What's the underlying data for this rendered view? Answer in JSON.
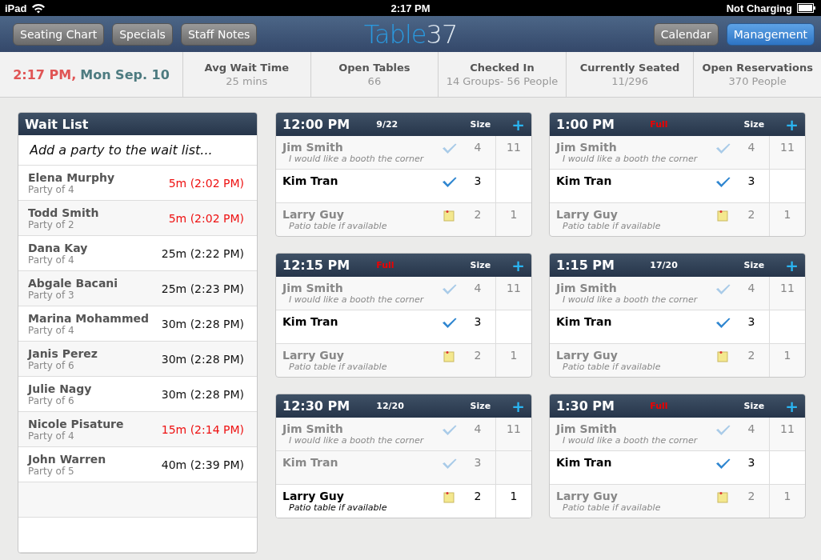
{
  "status_bar": {
    "device": "iPad",
    "time": "2:17 PM",
    "battery_text": "Not Charging"
  },
  "nav": {
    "left_buttons": [
      {
        "label": "Seating Chart",
        "selected": false
      },
      {
        "label": "Specials",
        "selected": false
      },
      {
        "label": "Staff Notes",
        "selected": false
      }
    ],
    "logo": {
      "part_1": "Table",
      "part_2": "37"
    },
    "right_buttons": [
      {
        "label": "Calendar",
        "selected": false
      },
      {
        "label": "Management",
        "selected": true
      }
    ]
  },
  "summary": {
    "time": "2:17 PM,",
    "date": "Mon Sep. 10",
    "stats": [
      {
        "label": "Avg Wait Time",
        "value": "25 mins"
      },
      {
        "label": "Open Tables",
        "value": "66"
      },
      {
        "label": "Checked In",
        "value": "14 Groups- 56 People"
      },
      {
        "label": "Currently Seated",
        "value": "11/296"
      },
      {
        "label": "Open Reservations",
        "value": "370 People"
      }
    ]
  },
  "wait_list": {
    "title": "Wait List",
    "placeholder": "Add a party to the wait list...",
    "parties": [
      {
        "name": "Elena Murphy",
        "party": "Party of 4",
        "wait": "5m (2:02 PM)",
        "overdue": true
      },
      {
        "name": "Todd Smith",
        "party": "Party of 2",
        "wait": "5m (2:02 PM)",
        "overdue": true
      },
      {
        "name": "Dana Kay",
        "party": "Party of 4",
        "wait": "25m (2:22 PM)",
        "overdue": false
      },
      {
        "name": "Abgale Bacani",
        "party": "Party of 3",
        "wait": "25m (2:23 PM)",
        "overdue": false
      },
      {
        "name": "Marina Mohammed",
        "party": "Party of 4",
        "wait": "30m (2:28 PM)",
        "overdue": false
      },
      {
        "name": "Janis Perez",
        "party": "Party of 6",
        "wait": "30m (2:28 PM)",
        "overdue": false
      },
      {
        "name": "Julie Nagy",
        "party": "Party of 6",
        "wait": "30m (2:28 PM)",
        "overdue": false
      },
      {
        "name": "Nicole Pisature",
        "party": "Party of 4",
        "wait": "15m (2:14 PM)",
        "overdue": true
      },
      {
        "name": "John Warren",
        "party": "Party of 5",
        "wait": "40m (2:39 PM)",
        "overdue": false
      }
    ]
  },
  "slots": [
    {
      "time": "12:00 PM",
      "status": "9/22",
      "full": false,
      "size_label": "Size",
      "add": "+",
      "reservations": [
        {
          "name": "Jim Smith",
          "note": "I would like a booth the corner",
          "kind": "check",
          "active": false,
          "size": "4",
          "table": "11"
        },
        {
          "name": "Kim Tran",
          "kind": "check",
          "active": true,
          "size": "3"
        },
        {
          "name": "Larry Guy",
          "note": "Patio table if available",
          "kind": "note",
          "active": false,
          "size": "2",
          "table": "1"
        }
      ]
    },
    {
      "time": "1:00 PM",
      "status": "Full",
      "full": true,
      "size_label": "Size",
      "add": "+",
      "reservations": [
        {
          "name": "Jim Smith",
          "note": "I would like a booth the corner",
          "kind": "check",
          "active": false,
          "size": "4",
          "table": "11"
        },
        {
          "name": "Kim Tran",
          "kind": "check",
          "active": true,
          "size": "3"
        },
        {
          "name": "Larry Guy",
          "note": "Patio table if available",
          "kind": "note",
          "active": false,
          "size": "2",
          "table": "1"
        }
      ]
    },
    {
      "time": "12:15 PM",
      "status": "Full",
      "full": true,
      "size_label": "Size",
      "add": "+",
      "reservations": [
        {
          "name": "Jim Smith",
          "note": "I would like a booth the corner",
          "kind": "check",
          "active": false,
          "size": "4",
          "table": "11"
        },
        {
          "name": "Kim Tran",
          "kind": "check",
          "active": true,
          "size": "3"
        },
        {
          "name": "Larry Guy",
          "note": "Patio table if available",
          "kind": "note",
          "active": false,
          "size": "2",
          "table": "1"
        }
      ]
    },
    {
      "time": "1:15 PM",
      "status": "17/20",
      "full": false,
      "size_label": "Size",
      "add": "+",
      "reservations": [
        {
          "name": "Jim Smith",
          "note": "I would like a booth the corner",
          "kind": "check",
          "active": false,
          "size": "4",
          "table": "11"
        },
        {
          "name": "Kim Tran",
          "kind": "check",
          "active": true,
          "size": "3"
        },
        {
          "name": "Larry Guy",
          "note": "Patio table if available",
          "kind": "note",
          "active": false,
          "size": "2",
          "table": "1"
        }
      ]
    },
    {
      "time": "12:30 PM",
      "status": "12/20",
      "full": false,
      "size_label": "Size",
      "add": "+",
      "reservations": [
        {
          "name": "Jim Smith",
          "note": "I would like a booth the corner",
          "kind": "check",
          "active": false,
          "size": "4",
          "table": "11"
        },
        {
          "name": "Kim Tran",
          "kind": "check",
          "active": false,
          "size": "3"
        },
        {
          "name": "Larry Guy",
          "note": "Patio table if available",
          "kind": "note",
          "active": true,
          "size": "2",
          "table": "1"
        }
      ]
    },
    {
      "time": "1:30 PM",
      "status": "Full",
      "full": true,
      "size_label": "Size",
      "add": "+",
      "reservations": [
        {
          "name": "Jim Smith",
          "note": "I would like a booth the corner",
          "kind": "check",
          "active": false,
          "size": "4",
          "table": "11"
        },
        {
          "name": "Kim Tran",
          "kind": "check",
          "active": true,
          "size": "3"
        },
        {
          "name": "Larry Guy",
          "note": "Patio table if available",
          "kind": "note",
          "active": false,
          "size": "2",
          "table": "1"
        }
      ]
    }
  ]
}
